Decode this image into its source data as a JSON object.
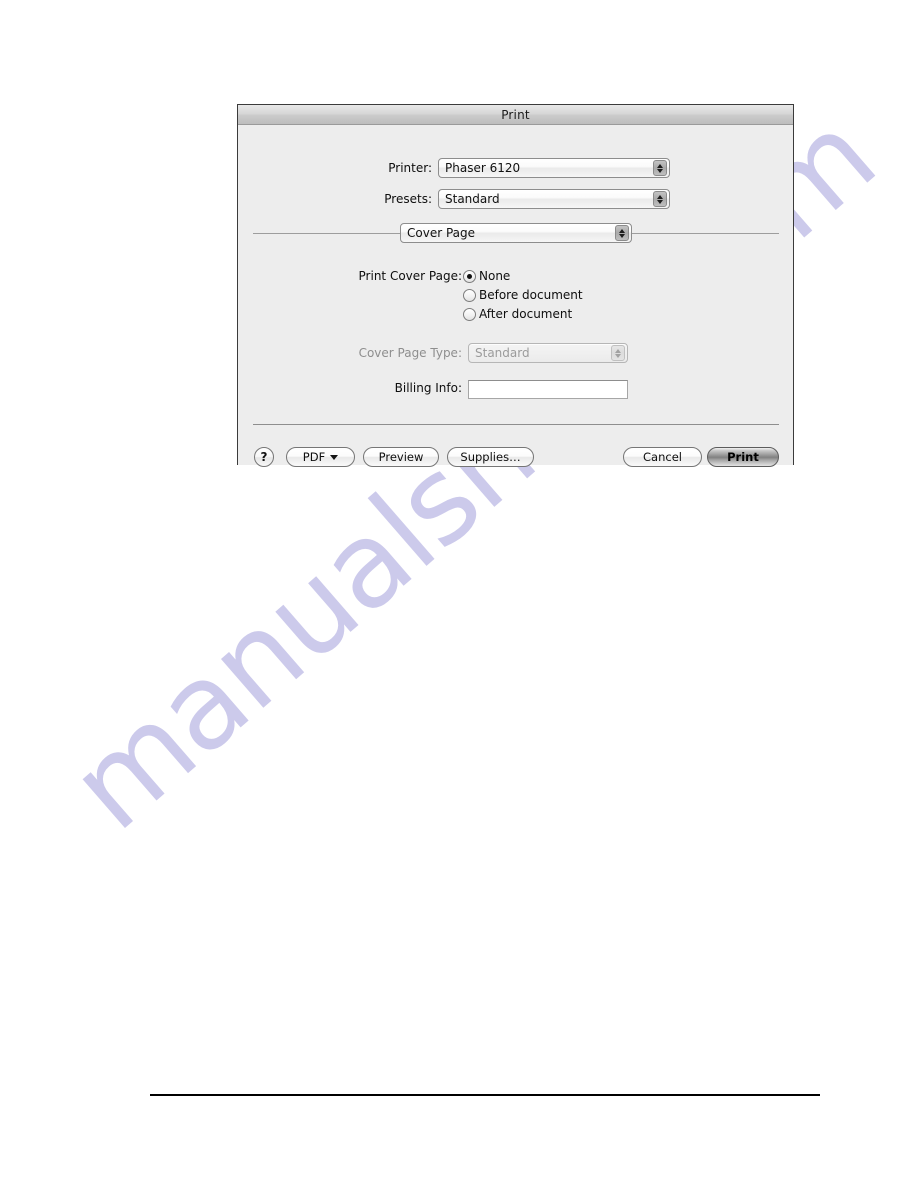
{
  "page": {
    "background_color": "#ffffff",
    "watermark_text": "manualshive.com",
    "watermark_color": "#b9b6e4"
  },
  "dialog": {
    "title": "Print",
    "rows": {
      "printer": {
        "label": "Printer:",
        "value": "Phaser 6120"
      },
      "presets": {
        "label": "Presets:",
        "value": "Standard"
      },
      "pane": {
        "value": "Cover Page"
      },
      "print_cover_page": {
        "label": "Print Cover Page:",
        "options": [
          {
            "label": "None",
            "selected": true
          },
          {
            "label": "Before document",
            "selected": false
          },
          {
            "label": "After document",
            "selected": false
          }
        ]
      },
      "cover_page_type": {
        "label": "Cover Page Type:",
        "value": "Standard",
        "disabled": true
      },
      "billing_info": {
        "label": "Billing Info:",
        "value": "",
        "placeholder": ""
      }
    },
    "buttons": {
      "help": "?",
      "pdf": "PDF",
      "preview": "Preview",
      "supplies": "Supplies…",
      "cancel": "Cancel",
      "print": "Print"
    }
  }
}
